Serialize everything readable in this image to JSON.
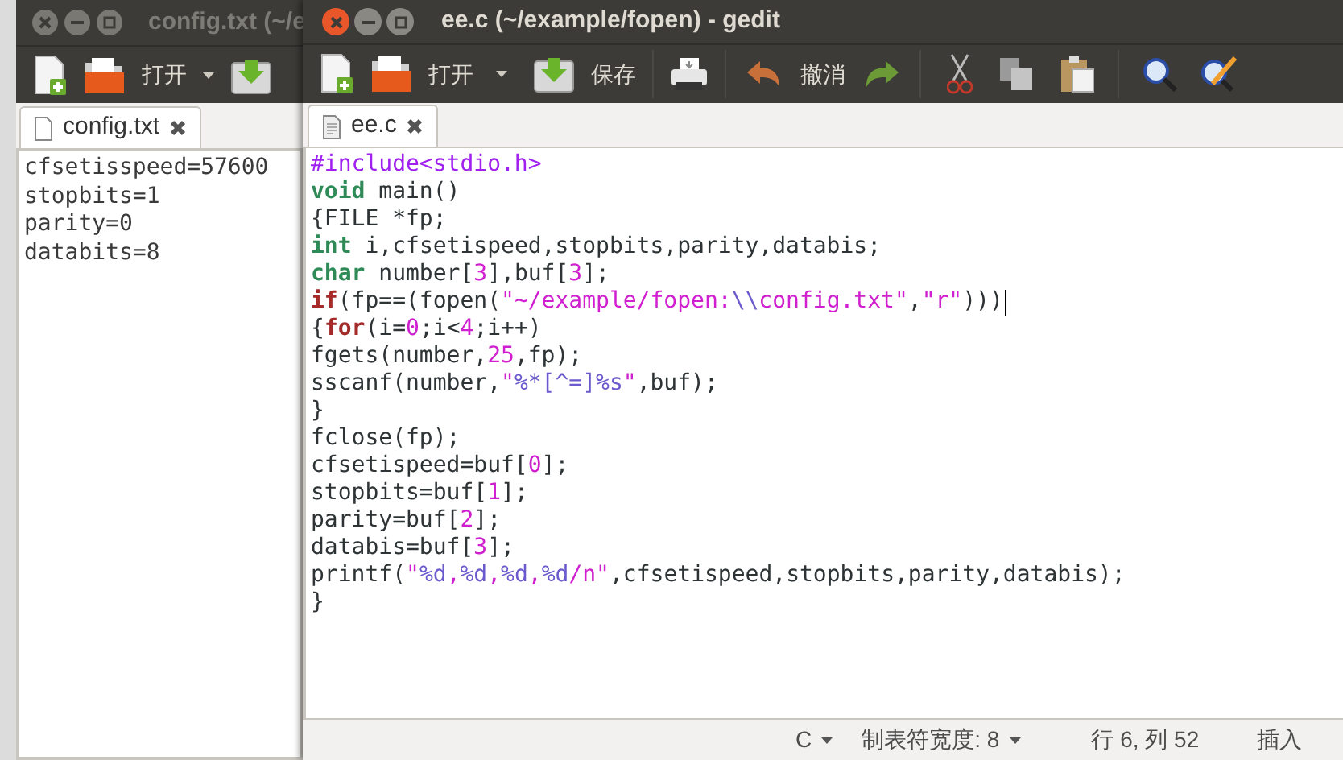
{
  "back_window": {
    "title": "config.txt (~/e",
    "toolbar": {
      "open_label": "打开"
    },
    "tab": {
      "label": "config.txt",
      "selected": true
    },
    "lines": [
      "cfsetisspeed=57600",
      "stopbits=1",
      "parity=0",
      "databits=8"
    ]
  },
  "front_window": {
    "title": "ee.c (~/example/fopen) - gedit",
    "toolbar": {
      "open_label": "打开",
      "save_label": "保存",
      "undo_label": "撤消"
    },
    "tab": {
      "label": "ee.c",
      "selected": true
    },
    "code_lines": [
      {
        "cursor": false,
        "tokens": [
          {
            "kind": "preproc",
            "text": "#include<stdio.h>"
          }
        ]
      },
      {
        "cursor": false,
        "tokens": [
          {
            "kind": "type",
            "text": "void"
          },
          {
            "kind": "plain",
            "text": " main()"
          }
        ]
      },
      {
        "cursor": false,
        "tokens": [
          {
            "kind": "plain",
            "text": "{FILE *fp;"
          }
        ]
      },
      {
        "cursor": false,
        "tokens": [
          {
            "kind": "type",
            "text": "int"
          },
          {
            "kind": "plain",
            "text": " i,cfsetispeed,stopbits,parity,databis;"
          }
        ]
      },
      {
        "cursor": false,
        "tokens": [
          {
            "kind": "type",
            "text": "char"
          },
          {
            "kind": "plain",
            "text": " number["
          },
          {
            "kind": "number",
            "text": "3"
          },
          {
            "kind": "plain",
            "text": "],buf["
          },
          {
            "kind": "number",
            "text": "3"
          },
          {
            "kind": "plain",
            "text": "];"
          }
        ]
      },
      {
        "cursor": true,
        "tokens": [
          {
            "kind": "keyword",
            "text": "if"
          },
          {
            "kind": "plain",
            "text": "(fp==(fopen("
          },
          {
            "kind": "string",
            "text": "\"~/example/fopen:"
          },
          {
            "kind": "escape",
            "text": "\\\\"
          },
          {
            "kind": "string",
            "text": "config.txt\""
          },
          {
            "kind": "plain",
            "text": ","
          },
          {
            "kind": "string",
            "text": "\"r\""
          },
          {
            "kind": "plain",
            "text": ")))"
          }
        ]
      },
      {
        "cursor": false,
        "tokens": [
          {
            "kind": "plain",
            "text": "{"
          },
          {
            "kind": "keyword",
            "text": "for"
          },
          {
            "kind": "plain",
            "text": "(i="
          },
          {
            "kind": "number",
            "text": "0"
          },
          {
            "kind": "plain",
            "text": ";i<"
          },
          {
            "kind": "number",
            "text": "4"
          },
          {
            "kind": "plain",
            "text": ";i++)"
          }
        ]
      },
      {
        "cursor": false,
        "tokens": [
          {
            "kind": "plain",
            "text": "fgets(number,"
          },
          {
            "kind": "number",
            "text": "25"
          },
          {
            "kind": "plain",
            "text": ",fp);"
          }
        ]
      },
      {
        "cursor": false,
        "tokens": [
          {
            "kind": "plain",
            "text": "sscanf(number,"
          },
          {
            "kind": "string",
            "text": "\""
          },
          {
            "kind": "escape",
            "text": "%*[^=]%s"
          },
          {
            "kind": "string",
            "text": "\""
          },
          {
            "kind": "plain",
            "text": ",buf);"
          }
        ]
      },
      {
        "cursor": false,
        "tokens": [
          {
            "kind": "plain",
            "text": "}"
          }
        ]
      },
      {
        "cursor": false,
        "tokens": [
          {
            "kind": "plain",
            "text": "fclose(fp);"
          }
        ]
      },
      {
        "cursor": false,
        "tokens": [
          {
            "kind": "plain",
            "text": "cfsetispeed=buf["
          },
          {
            "kind": "number",
            "text": "0"
          },
          {
            "kind": "plain",
            "text": "];"
          }
        ]
      },
      {
        "cursor": false,
        "tokens": [
          {
            "kind": "plain",
            "text": "stopbits=buf["
          },
          {
            "kind": "number",
            "text": "1"
          },
          {
            "kind": "plain",
            "text": "];"
          }
        ]
      },
      {
        "cursor": false,
        "tokens": [
          {
            "kind": "plain",
            "text": "parity=buf["
          },
          {
            "kind": "number",
            "text": "2"
          },
          {
            "kind": "plain",
            "text": "];"
          }
        ]
      },
      {
        "cursor": false,
        "tokens": [
          {
            "kind": "plain",
            "text": "databis=buf["
          },
          {
            "kind": "number",
            "text": "3"
          },
          {
            "kind": "plain",
            "text": "];"
          }
        ]
      },
      {
        "cursor": false,
        "tokens": [
          {
            "kind": "plain",
            "text": "printf("
          },
          {
            "kind": "string",
            "text": "\""
          },
          {
            "kind": "escape",
            "text": "%d"
          },
          {
            "kind": "string",
            "text": ","
          },
          {
            "kind": "escape",
            "text": "%d"
          },
          {
            "kind": "string",
            "text": ","
          },
          {
            "kind": "escape",
            "text": "%d"
          },
          {
            "kind": "string",
            "text": ","
          },
          {
            "kind": "escape",
            "text": "%d"
          },
          {
            "kind": "string",
            "text": "/n\""
          },
          {
            "kind": "plain",
            "text": ",cfsetispeed,stopbits,parity,databis);"
          }
        ]
      },
      {
        "cursor": false,
        "tokens": [
          {
            "kind": "plain",
            "text": "}"
          }
        ]
      }
    ],
    "status_bar": {
      "language": "C",
      "tab_width": "制表符宽度: 8",
      "position": "行 6, 列 52",
      "mode": "插入"
    }
  }
}
